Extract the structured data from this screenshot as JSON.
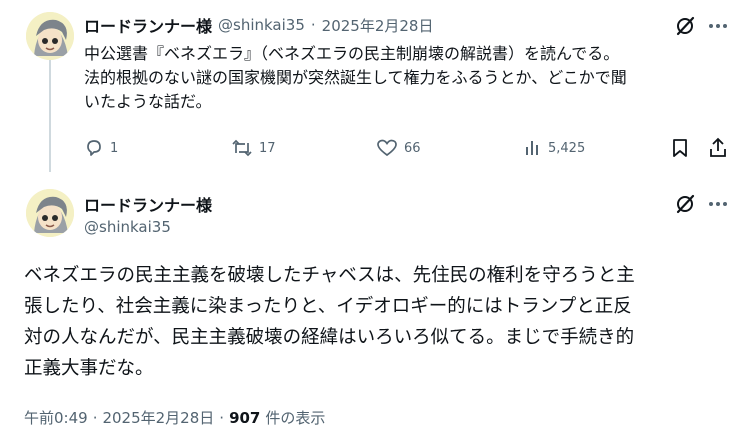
{
  "reply_target": {
    "author_name": "ロードランナー様",
    "handle": "@shinkai35",
    "separator": "·",
    "date": "2025年2月28日",
    "text_line1": "中公選書『ベネズエラ』（ベネズエラの民主制崩壊の解説書）を読んでる。",
    "text_line2": "法的根拠のない謎の国家機関が突然誕生して権力をふるうとか、どこかで聞",
    "text_line3": "いたような話だ。",
    "replies": "1",
    "reposts": "17",
    "likes": "66",
    "views": "5,425"
  },
  "main_post": {
    "author_name": "ロードランナー様",
    "handle": "@shinkai35",
    "text_line1": "ベネズエラの民主主義を破壊したチャベスは、先住民の権利を守ろうと主",
    "text_line2": "張したり、社会主義に染まったりと、イデオロギー的にはトランプと正反",
    "text_line3": "対の人なんだが、民主主義破壊の経緯はいろいろ似てる。まじで手続き的",
    "text_line4": "正義大事だな。",
    "time": "午前0:49",
    "separator": "·",
    "date": "2025年2月28日",
    "separator2": "·",
    "view_count": "907",
    "views_label": "件の表示"
  },
  "icons": {
    "grok": "grok-slash-icon",
    "more": "more-dots-icon",
    "reply": "reply-bubble-icon",
    "repost": "repost-arrows-icon",
    "like": "heart-icon",
    "views": "views-bars-icon",
    "bookmark": "bookmark-icon",
    "share": "share-icon"
  },
  "colors": {
    "text": "#0f1419",
    "muted": "#536471",
    "line": "#cfd9de"
  }
}
